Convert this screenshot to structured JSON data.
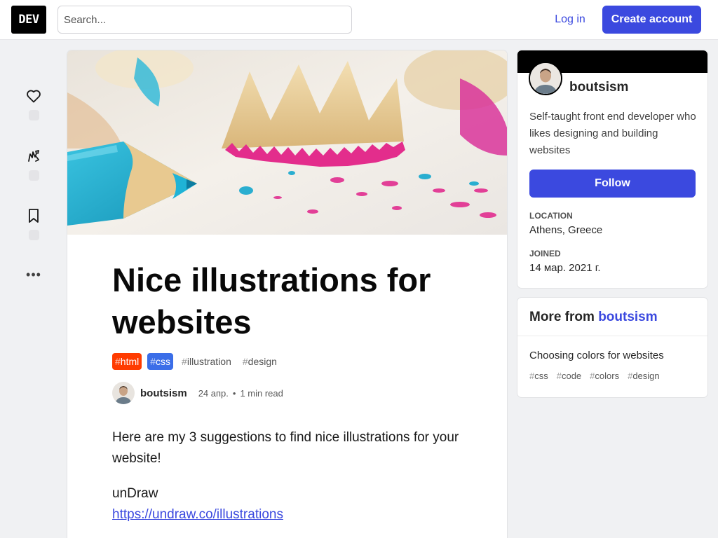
{
  "header": {
    "logo": "DEV",
    "search_placeholder": "Search...",
    "login_label": "Log in",
    "create_account_label": "Create account"
  },
  "reactions": [
    {
      "icon": "heart-icon"
    },
    {
      "icon": "unicorn-icon"
    },
    {
      "icon": "bookmark-icon"
    }
  ],
  "more_label": "•••",
  "article": {
    "title": "Nice illustrations for websites",
    "tags": [
      {
        "hash": "#",
        "name": "html"
      },
      {
        "hash": "#",
        "name": "css"
      },
      {
        "hash": "#",
        "name": "illustration"
      },
      {
        "hash": "#",
        "name": "design"
      }
    ],
    "author": "boutsism",
    "date": "24 апр.",
    "separator": "•",
    "read_time": "1 min read",
    "paragraph1": "Here are my 3 suggestions to find nice illustrations for your website!",
    "paragraph2_title": "unDraw",
    "paragraph2_link": "https://undraw.co/illustrations"
  },
  "profile": {
    "name": "boutsism",
    "bio": "Self-taught front end developer who likes designing and building websites",
    "follow_label": "Follow",
    "location_label": "LOCATION",
    "location": "Athens, Greece",
    "joined_label": "JOINED",
    "joined": "14 мар. 2021 г."
  },
  "more_from": {
    "prefix": "More from",
    "author": "boutsism",
    "post_title": "Choosing colors for websites",
    "tags": [
      {
        "hash": "#",
        "name": "css"
      },
      {
        "hash": "#",
        "name": "code"
      },
      {
        "hash": "#",
        "name": "colors"
      },
      {
        "hash": "#",
        "name": "design"
      }
    ]
  },
  "colors": {
    "accent": "#3b49df",
    "html_tag": "#ff3b00",
    "css_tag": "#3b6ee8",
    "background": "#f0f1f3"
  }
}
